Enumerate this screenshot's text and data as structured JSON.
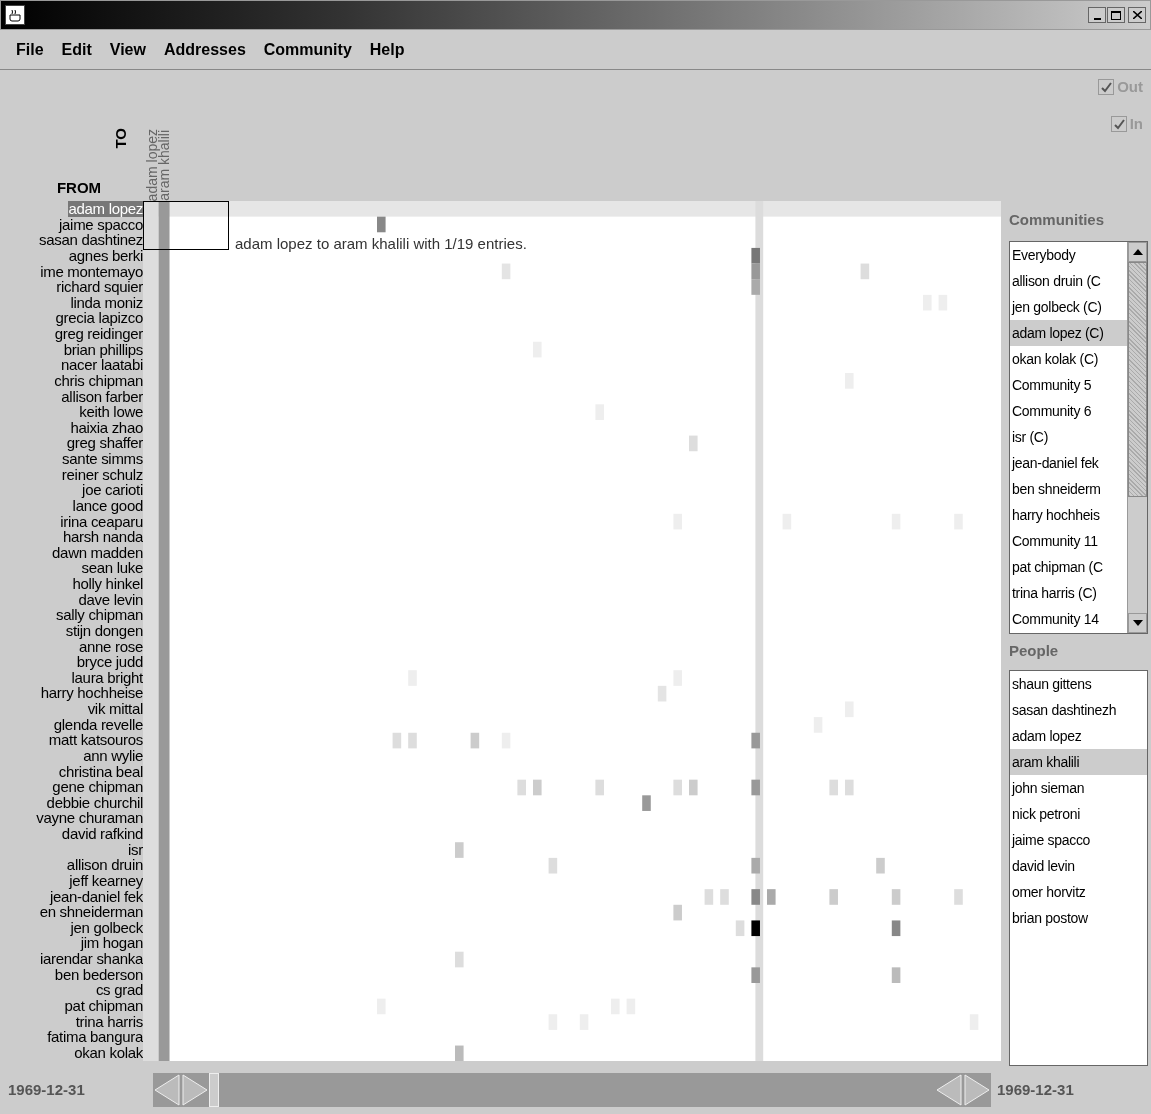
{
  "menu": [
    {
      "label": "File"
    },
    {
      "label": "Edit"
    },
    {
      "label": "View"
    },
    {
      "label": "Addresses"
    },
    {
      "label": "Community"
    },
    {
      "label": "Help"
    }
  ],
  "matrix": {
    "to_label": "TO",
    "from_label": "FROM",
    "column_headers": [
      "adam lopez",
      "aram khalili"
    ],
    "tooltip": "adam lopez to aram khalili with 1/19 entries.",
    "rows": [
      {
        "name": "adam lopez",
        "selected": true
      },
      {
        "name": "jaime spacco",
        "selected": false
      },
      {
        "name": "sasan dashtinez",
        "selected": false
      },
      {
        "name": "agnes berki",
        "selected": false
      },
      {
        "name": "ime montemayo",
        "selected": false
      },
      {
        "name": "richard squier",
        "selected": false
      },
      {
        "name": "linda moniz",
        "selected": false
      },
      {
        "name": "grecia lapizco",
        "selected": false
      },
      {
        "name": "greg reidinger",
        "selected": false
      },
      {
        "name": "brian phillips",
        "selected": false
      },
      {
        "name": "nacer laatabi",
        "selected": false
      },
      {
        "name": "chris chipman",
        "selected": false
      },
      {
        "name": "allison farber",
        "selected": false
      },
      {
        "name": "keith lowe",
        "selected": false
      },
      {
        "name": "haixia zhao",
        "selected": false
      },
      {
        "name": "greg shaffer",
        "selected": false
      },
      {
        "name": "sante simms",
        "selected": false
      },
      {
        "name": "reiner schulz",
        "selected": false
      },
      {
        "name": "joe carioti",
        "selected": false
      },
      {
        "name": "lance good",
        "selected": false
      },
      {
        "name": "irina ceaparu",
        "selected": false
      },
      {
        "name": "harsh nanda",
        "selected": false
      },
      {
        "name": "dawn madden",
        "selected": false
      },
      {
        "name": "sean luke",
        "selected": false
      },
      {
        "name": "holly hinkel",
        "selected": false
      },
      {
        "name": "dave levin",
        "selected": false
      },
      {
        "name": "sally chipman",
        "selected": false
      },
      {
        "name": "stijn dongen",
        "selected": false
      },
      {
        "name": "anne rose",
        "selected": false
      },
      {
        "name": "bryce judd",
        "selected": false
      },
      {
        "name": "laura bright",
        "selected": false
      },
      {
        "name": "harry hochheise",
        "selected": false
      },
      {
        "name": "vik mittal",
        "selected": false
      },
      {
        "name": "glenda revelle",
        "selected": false
      },
      {
        "name": "matt katsouros",
        "selected": false
      },
      {
        "name": "ann wylie",
        "selected": false
      },
      {
        "name": "christina beal",
        "selected": false
      },
      {
        "name": "gene chipman",
        "selected": false
      },
      {
        "name": "debbie churchil",
        "selected": false
      },
      {
        "name": "vayne churaman",
        "selected": false
      },
      {
        "name": "david rafkind",
        "selected": false
      },
      {
        "name": "isr",
        "selected": false
      },
      {
        "name": "allison druin",
        "selected": false
      },
      {
        "name": "jeff kearney",
        "selected": false
      },
      {
        "name": "jean-daniel fek",
        "selected": false
      },
      {
        "name": "en shneiderman",
        "selected": false
      },
      {
        "name": "jen golbeck",
        "selected": false
      },
      {
        "name": "jim hogan",
        "selected": false
      },
      {
        "name": "iarendar shanka",
        "selected": false
      },
      {
        "name": "ben bederson",
        "selected": false
      },
      {
        "name": "cs grad",
        "selected": false
      },
      {
        "name": "pat chipman",
        "selected": false
      },
      {
        "name": "trina harris",
        "selected": false
      },
      {
        "name": "fatima bangura",
        "selected": false
      },
      {
        "name": "okan kolak",
        "selected": false
      }
    ]
  },
  "filters": [
    {
      "label": "Out",
      "checked": true,
      "disabled": true
    },
    {
      "label": "In",
      "checked": true,
      "disabled": true
    }
  ],
  "communities": {
    "title": "Communities",
    "items": [
      {
        "label": "Everybody",
        "selected": false
      },
      {
        "label": "allison druin (C",
        "selected": false
      },
      {
        "label": "jen golbeck (C)",
        "selected": false
      },
      {
        "label": "adam lopez (C)",
        "selected": true
      },
      {
        "label": "okan kolak (C)",
        "selected": false
      },
      {
        "label": "Community 5",
        "selected": false
      },
      {
        "label": "Community 6",
        "selected": false
      },
      {
        "label": "isr (C)",
        "selected": false
      },
      {
        "label": "jean-daniel fek",
        "selected": false
      },
      {
        "label": "ben shneiderm",
        "selected": false
      },
      {
        "label": "harry hochheis",
        "selected": false
      },
      {
        "label": "Community 11",
        "selected": false
      },
      {
        "label": "pat chipman (C",
        "selected": false
      },
      {
        "label": "trina harris (C)",
        "selected": false
      },
      {
        "label": "Community 14",
        "selected": false
      }
    ]
  },
  "people": {
    "title": "People",
    "items": [
      {
        "label": "shaun gittens",
        "selected": false
      },
      {
        "label": "sasan dashtinezh",
        "selected": false
      },
      {
        "label": "adam lopez",
        "selected": false
      },
      {
        "label": "aram khalili",
        "selected": true
      },
      {
        "label": "john sieman",
        "selected": false
      },
      {
        "label": "nick petroni",
        "selected": false
      },
      {
        "label": "jaime spacco",
        "selected": false
      },
      {
        "label": "david levin",
        "selected": false
      },
      {
        "label": "omer horvitz",
        "selected": false
      },
      {
        "label": "brian postow",
        "selected": false
      }
    ]
  },
  "time_range": {
    "start": "1969-12-31",
    "end": "1969-12-31",
    "level": 0
  }
}
